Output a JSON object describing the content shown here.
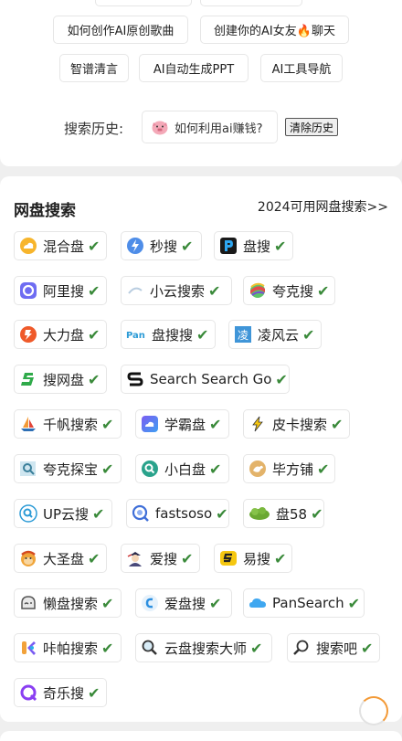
{
  "hot_topics": [
    {
      "label": "如何创作AI原创歌曲"
    },
    {
      "label": "创建你的AI女友🔥聊天"
    },
    {
      "label": "智谱清言"
    },
    {
      "label": "AI自动生成PPT"
    },
    {
      "label": "AI工具导航"
    }
  ],
  "history": {
    "label": "搜索历史:",
    "items": [
      {
        "text": "如何利用ai赚钱?"
      }
    ],
    "clear_label": "清除历史"
  },
  "netdisk": {
    "title": "网盘搜索",
    "more_link": "2024可用网盘搜索>>",
    "check_mark": "✔",
    "engines": [
      {
        "name": "混合盘",
        "icon": "cloud-icon"
      },
      {
        "name": "秒搜",
        "icon": "lightning-icon"
      },
      {
        "name": "盘搜",
        "icon": "p-logo-icon"
      },
      {
        "name": "阿里搜",
        "icon": "aliyun-icon"
      },
      {
        "name": "小云搜索",
        "icon": "arc-icon"
      },
      {
        "name": "夸克搜",
        "icon": "colorful-ball-icon"
      },
      {
        "name": "大力盘",
        "icon": "dali-icon"
      },
      {
        "name": "盘搜搜",
        "icon": "pan-text-icon"
      },
      {
        "name": "凌风云",
        "icon": "ling-icon"
      },
      {
        "name": "搜网盘",
        "icon": "green-s-icon"
      },
      {
        "name": "Search Search Go",
        "icon": "black-s-icon"
      },
      {
        "name": "千帆搜索",
        "icon": "sailboat-icon"
      },
      {
        "name": "学霸盘",
        "icon": "cloud-gradient-icon"
      },
      {
        "name": "皮卡搜索",
        "icon": "pika-icon"
      },
      {
        "name": "夸克探宝",
        "icon": "magnifier-box-icon"
      },
      {
        "name": "小白盘",
        "icon": "teal-magnifier-icon"
      },
      {
        "name": "毕方铺",
        "icon": "bird-icon"
      },
      {
        "name": "UP云搜",
        "icon": "up-magnifier-icon"
      },
      {
        "name": "fastsoso",
        "icon": "fastsoso-icon"
      },
      {
        "name": "盘58",
        "icon": "green-blob-icon"
      },
      {
        "name": "大圣盘",
        "icon": "monkey-icon"
      },
      {
        "name": "爱搜",
        "icon": "character-icon"
      },
      {
        "name": "易搜",
        "icon": "yellow-s-icon"
      },
      {
        "name": "懒盘搜索",
        "icon": "lazy-icon"
      },
      {
        "name": "爱盘搜",
        "icon": "blue-c-icon"
      },
      {
        "name": "PanSearch",
        "icon": "blue-cloud-icon"
      },
      {
        "name": "咔帕搜索",
        "icon": "kapa-icon"
      },
      {
        "name": "云盘搜索大师",
        "icon": "search-icon"
      },
      {
        "name": "搜索吧",
        "icon": "search-icon"
      },
      {
        "name": "奇乐搜",
        "icon": "q-logo-icon"
      }
    ]
  },
  "colors": {
    "check": "#3a8a3a",
    "spinner": "#f39a37",
    "border": "#e6e6e6"
  }
}
